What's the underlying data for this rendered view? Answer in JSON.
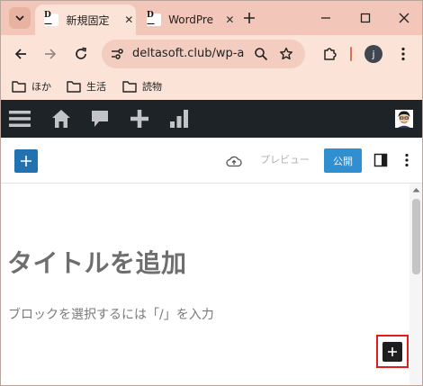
{
  "browser": {
    "tabs": [
      {
        "title": "新規固定",
        "favicon_text": "D—",
        "close_label": "✕"
      },
      {
        "title": "WordPre",
        "favicon_text": "D—",
        "close_label": "✕"
      }
    ],
    "url": "deltasoft.club/wp-a...",
    "profile_initial": "j",
    "bookmarks": [
      {
        "label": "ほか",
        "icon": "folder-icon"
      },
      {
        "label": "生活",
        "icon": "folder-icon"
      },
      {
        "label": "読物",
        "icon": "folder-icon"
      }
    ],
    "colors": {
      "tabstrip": "#f2c6b8",
      "toolbar": "#fbe3d8",
      "separator": "#e46b5a"
    }
  },
  "wp_admin_bar": {
    "items": [
      "menu-icon",
      "home-icon",
      "comments-icon",
      "plus-icon",
      "stats-icon"
    ],
    "background": "#1d2327"
  },
  "editor": {
    "preview_label": "プレビュー",
    "publish_label": "公開",
    "title_placeholder": "タイトルを追加",
    "block_placeholder": "ブロックを選択するには「/」を入力",
    "accent": "#2271b1",
    "highlight": "#e01d1d"
  }
}
